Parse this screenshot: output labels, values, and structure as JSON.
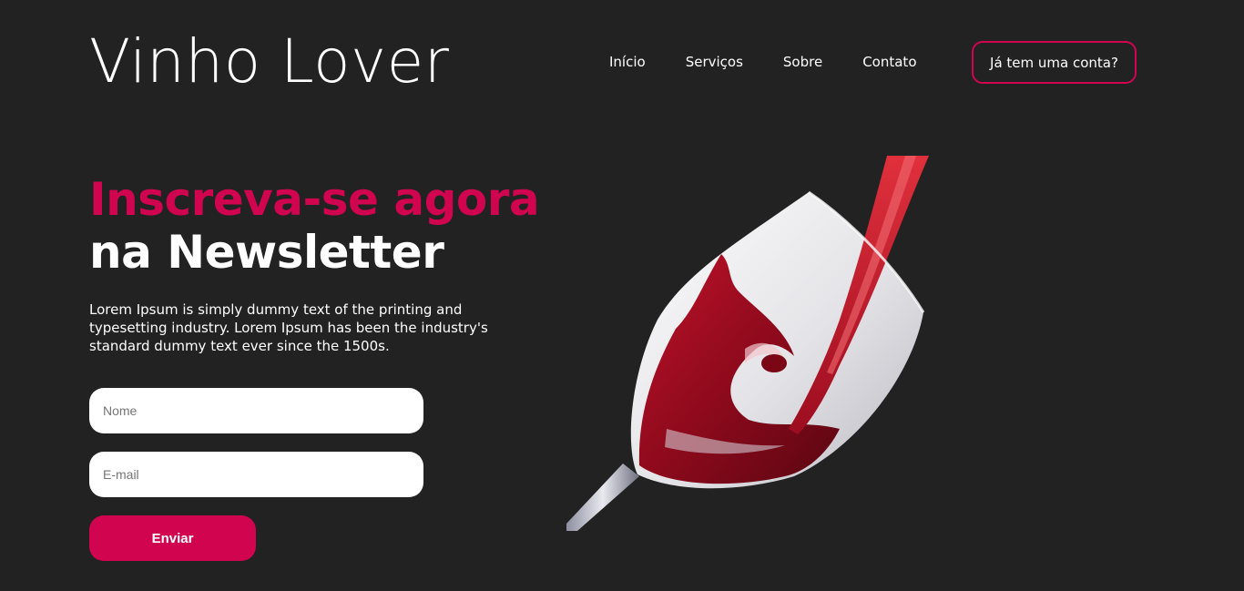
{
  "header": {
    "logo": "Vinho Lover",
    "nav": [
      {
        "label": "Início"
      },
      {
        "label": "Serviços"
      },
      {
        "label": "Sobre"
      },
      {
        "label": "Contato"
      }
    ],
    "account_button": "Já tem uma conta?"
  },
  "hero": {
    "title_accent": "Inscreva-se agora",
    "title_main": "na Newsletter",
    "description": "Lorem Ipsum is simply dummy text of the printing and typesetting industry. Lorem Ipsum has been the industry's standard dummy text ever since the 1500s.",
    "form": {
      "name_placeholder": "Nome",
      "name_value": "",
      "email_placeholder": "E-mail",
      "email_value": "",
      "submit_label": "Enviar"
    },
    "image_icon": "wine-glass-pour-icon"
  },
  "colors": {
    "background": "#222222",
    "accent": "#d1054f",
    "text": "#ffffff"
  }
}
